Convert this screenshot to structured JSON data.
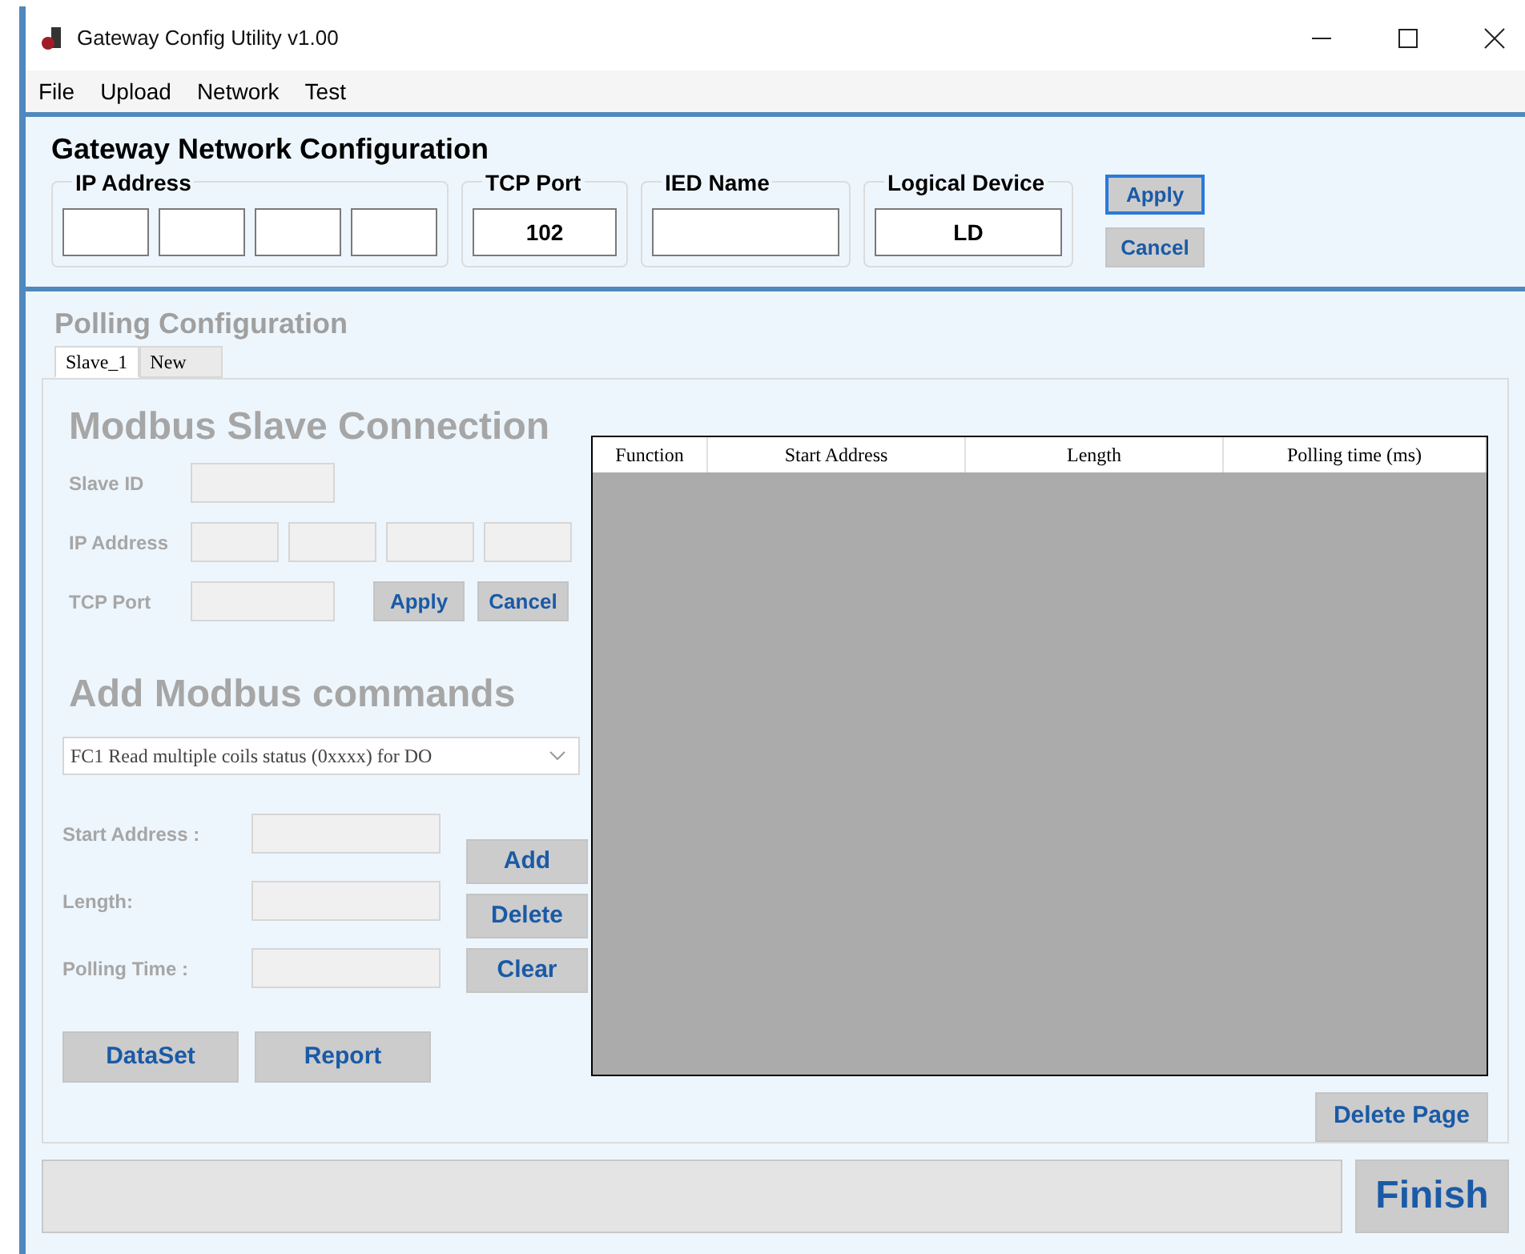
{
  "window": {
    "title": "Gateway Config Utility v1.00"
  },
  "menu": [
    "File",
    "Upload",
    "Network",
    "Test"
  ],
  "gateway": {
    "title": "Gateway Network Configuration",
    "ip_label": "IP Address",
    "tcp_port": {
      "label": "TCP Port",
      "value": "102"
    },
    "ied_name": {
      "label": "IED Name"
    },
    "logical_device": {
      "label": "Logical Device",
      "value": "LD"
    },
    "buttons": [
      {
        "label": "Apply",
        "focused": true
      },
      {
        "label": "Cancel",
        "focused": false
      }
    ]
  },
  "polling": {
    "title": "Polling Configuration",
    "tabs": [
      {
        "label": "Slave_1",
        "selected": true
      },
      {
        "label": "New",
        "selected": false
      }
    ],
    "slave": {
      "title": "Modbus Slave Connection",
      "slave_id_label": "Slave ID",
      "ip_label": "IP Address",
      "tcp_port_label": "TCP Port",
      "buttons": [
        "Apply",
        "Cancel"
      ]
    },
    "commands": {
      "title": "Add Modbus commands",
      "function": "FC1 Read multiple coils status (0xxxx) for DO",
      "field_labels": [
        "Start Address :",
        "Length:",
        "Polling Time :"
      ],
      "buttons": [
        "Add",
        "Delete",
        "Clear"
      ]
    },
    "table": {
      "columns": [
        "Function",
        "Start Address",
        "Length",
        "Polling time (ms)"
      ]
    },
    "bottom_buttons": [
      "DataSet",
      "Report"
    ],
    "delete_page": "Delete Page"
  },
  "finish": "Finish"
}
